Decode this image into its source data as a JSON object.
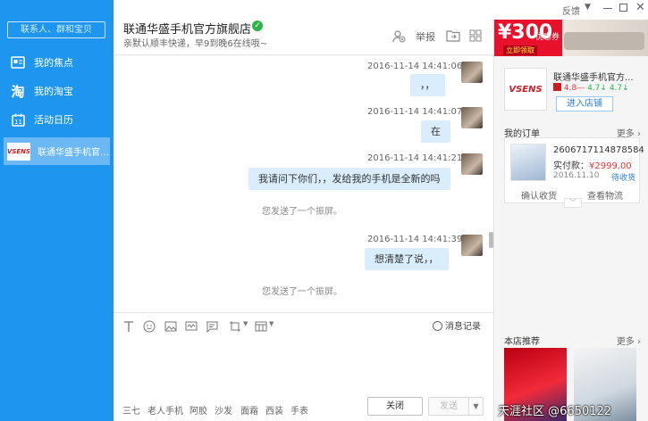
{
  "sidebar": {
    "search_placeholder": "联系人、群和宝贝",
    "items": [
      {
        "label": "我的焦点",
        "icon": "focus-icon"
      },
      {
        "label": "我的淘宝",
        "icon": "taobao-icon"
      },
      {
        "label": "活动日历",
        "icon": "calendar-icon"
      }
    ],
    "active_chat": {
      "label": "联通华盛手机官...",
      "logo_text": "VSENS"
    }
  },
  "header": {
    "title": "联通华盛手机官方旗舰店",
    "subtitle": "亲默认顺丰快递，早9到晚6在线哦~",
    "report_label": "举报"
  },
  "window": {
    "feedback_label": "反馈"
  },
  "chat": {
    "messages": [
      {
        "time": "2016-11-14 14:41:06",
        "text": "，，"
      },
      {
        "time": "2016-11-14 14:41:07",
        "text": "在"
      },
      {
        "time": "2016-11-14 14:41:21",
        "text": "我请问下你们，，发给我的手机是全新的吗"
      },
      {
        "time": "2016-11-14 14:41:39",
        "text": "想清楚了说，，"
      }
    ],
    "system_1": "您发送了一个振屏。",
    "system_2": "您发送了一个振屏。"
  },
  "input": {
    "history_label": "消息记录",
    "quick_phrases": [
      "三七",
      "老人手机",
      "阿胶",
      "沙发",
      "面霜",
      "西装",
      "手表"
    ],
    "close_label": "关闭",
    "send_label": "发送"
  },
  "right": {
    "banner": {
      "price": "¥300",
      "coupon": "优惠券",
      "cta": "立即领取"
    },
    "shop": {
      "name": "联通华盛手机官方...",
      "rating_1": "4.8",
      "rating_2": "4.7",
      "rating_3": "4.7",
      "enter_label": "进入店铺",
      "logo_text": "VSENS"
    },
    "orders_title": "我的订单",
    "more_label": "更多",
    "order": {
      "number": "2606717114878584",
      "paid_label": "实付款：",
      "paid_value": "¥2999.00",
      "date": "2016.11.10",
      "status": "待收货",
      "confirm_label": "确认收货",
      "logistics_label": "查看物流"
    },
    "recommend_title": "本店推荐",
    "recommend_more": "更多",
    "watermark": "天涯社区 @6650122"
  },
  "colors": {
    "sidebar": "#1e96f0",
    "bubble": "#d9edfc",
    "banner_red": "#e8102a"
  }
}
